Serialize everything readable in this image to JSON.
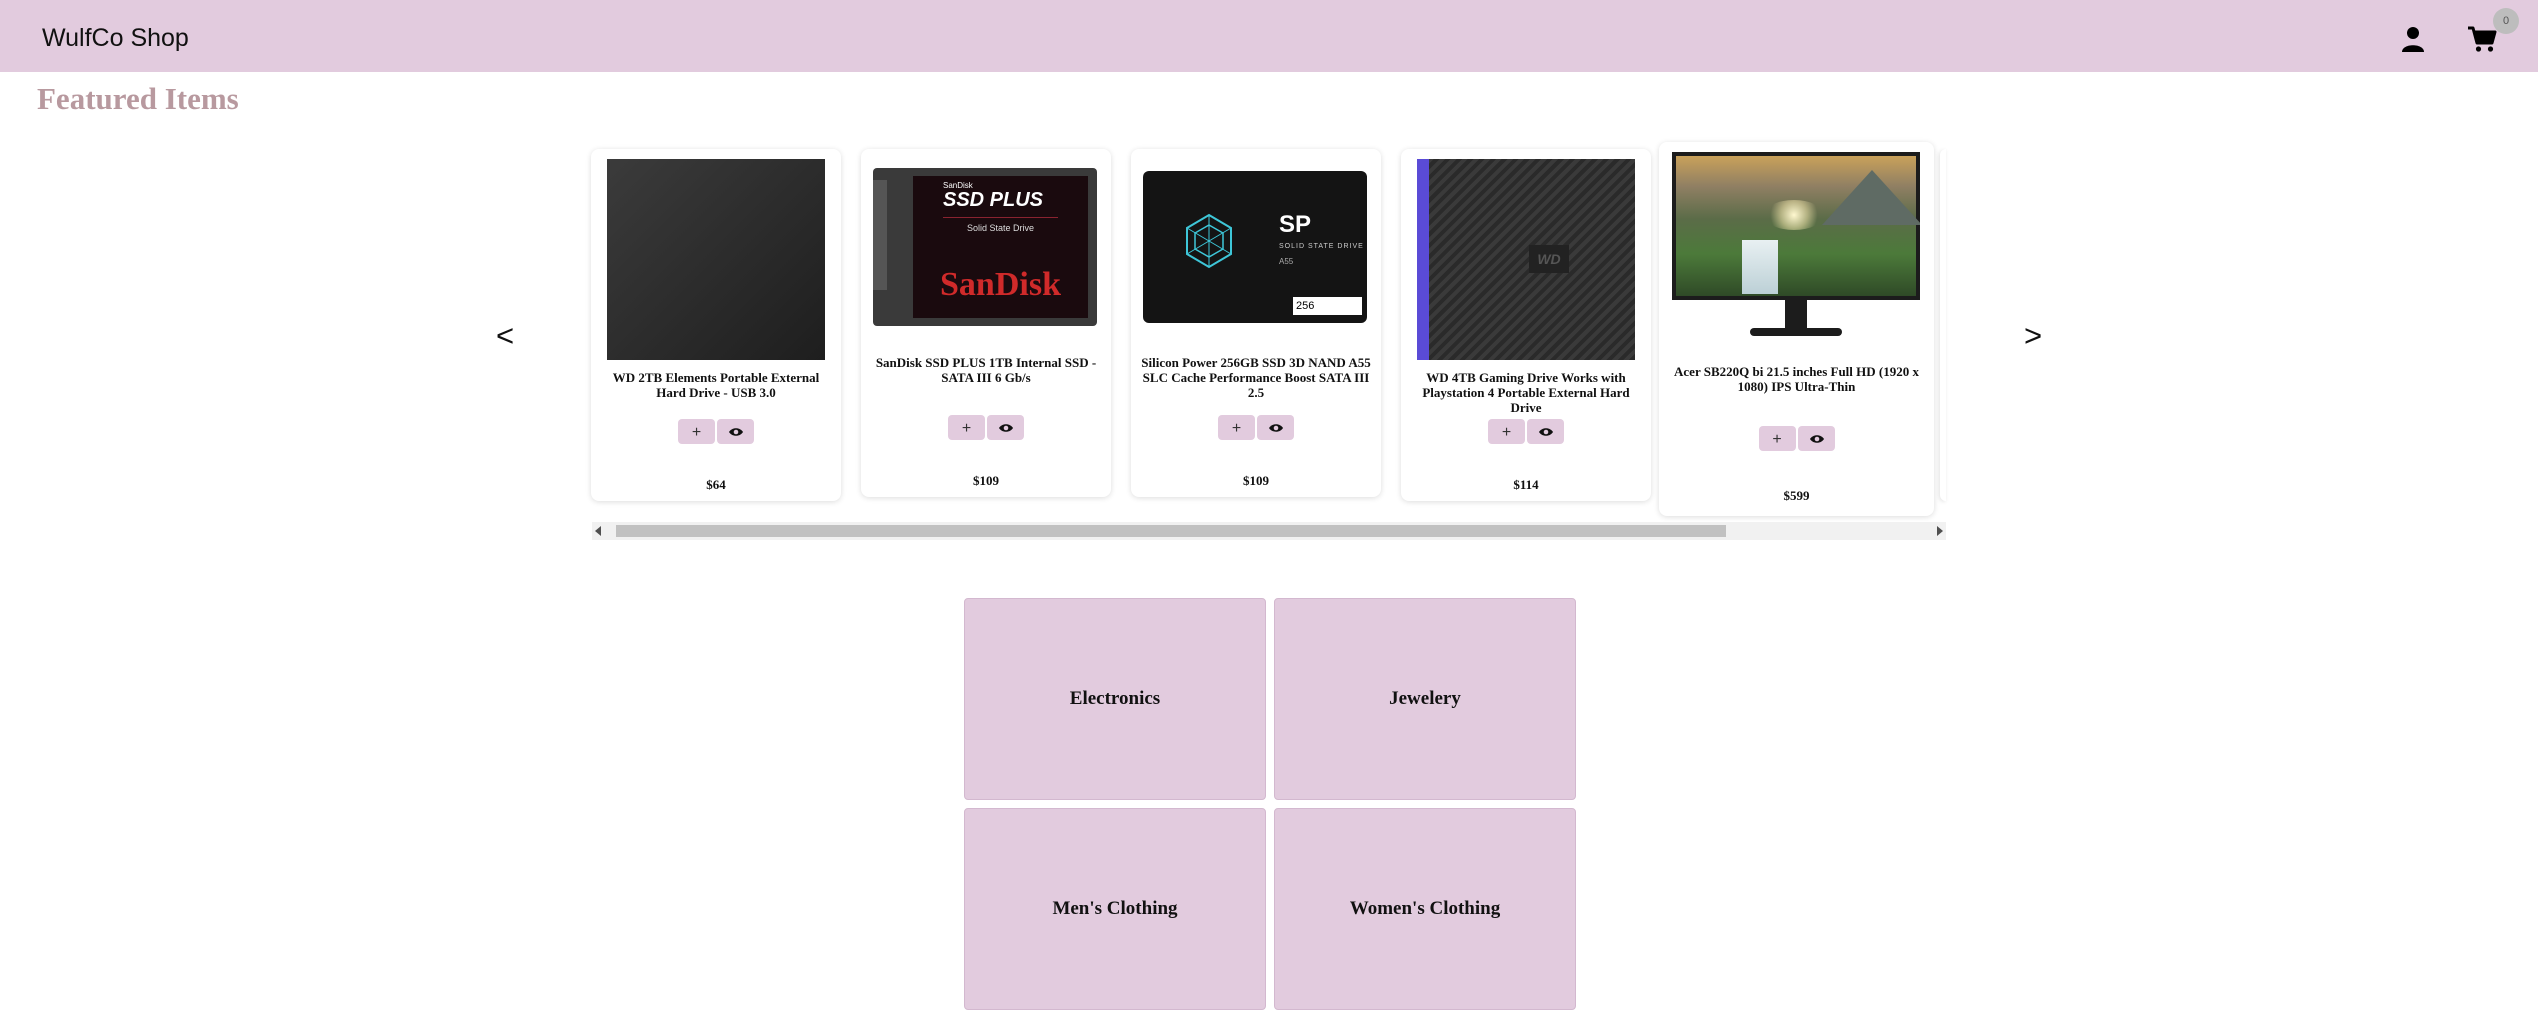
{
  "header": {
    "brand": "WulfCo Shop",
    "cart_count": "0",
    "user_icon": "user-icon",
    "cart_icon": "shopping-cart-icon",
    "background": "#e2cbde"
  },
  "featured": {
    "title": "Featured Items",
    "prev_label": "<",
    "next_label": ">",
    "products": [
      {
        "name": "WD 2TB Elements Portable External Hard Drive - USB 3.0",
        "price": "$64",
        "add_label": "+",
        "image": "black external hard drive"
      },
      {
        "name": "SanDisk SSD PLUS 1TB Internal SSD - SATA III 6 Gb/s",
        "price": "$109",
        "add_label": "+",
        "image": "SanDisk SSD PLUS drive",
        "img_brand_small": "SanDisk",
        "img_product": "SSD PLUS",
        "img_sub": "Solid State Drive",
        "img_logo": "SanDisk"
      },
      {
        "name": "Silicon Power 256GB SSD 3D NAND A55 SLC Cache Performance Boost SATA III 2.5",
        "price": "$109",
        "add_label": "+",
        "image": "Silicon Power SSD",
        "img_logo": "SP",
        "img_sub": "SOLID STATE DRIVE",
        "img_model": "A55",
        "img_capacity": "256"
      },
      {
        "name": "WD 4TB Gaming Drive Works with Playstation 4 Portable External Hard Drive",
        "price": "$114",
        "add_label": "+",
        "image": "WD gaming drive",
        "img_logo": "WD"
      },
      {
        "name": "Acer SB220Q bi 21.5 inches Full HD (1920 x 1080) IPS Ultra-Thin",
        "price": "$599",
        "add_label": "+",
        "image": "monitor with waterfall landscape"
      }
    ]
  },
  "categories": [
    {
      "label": "Electronics"
    },
    {
      "label": "Jewelery"
    },
    {
      "label": "Men's Clothing"
    },
    {
      "label": "Women's Clothing"
    }
  ]
}
